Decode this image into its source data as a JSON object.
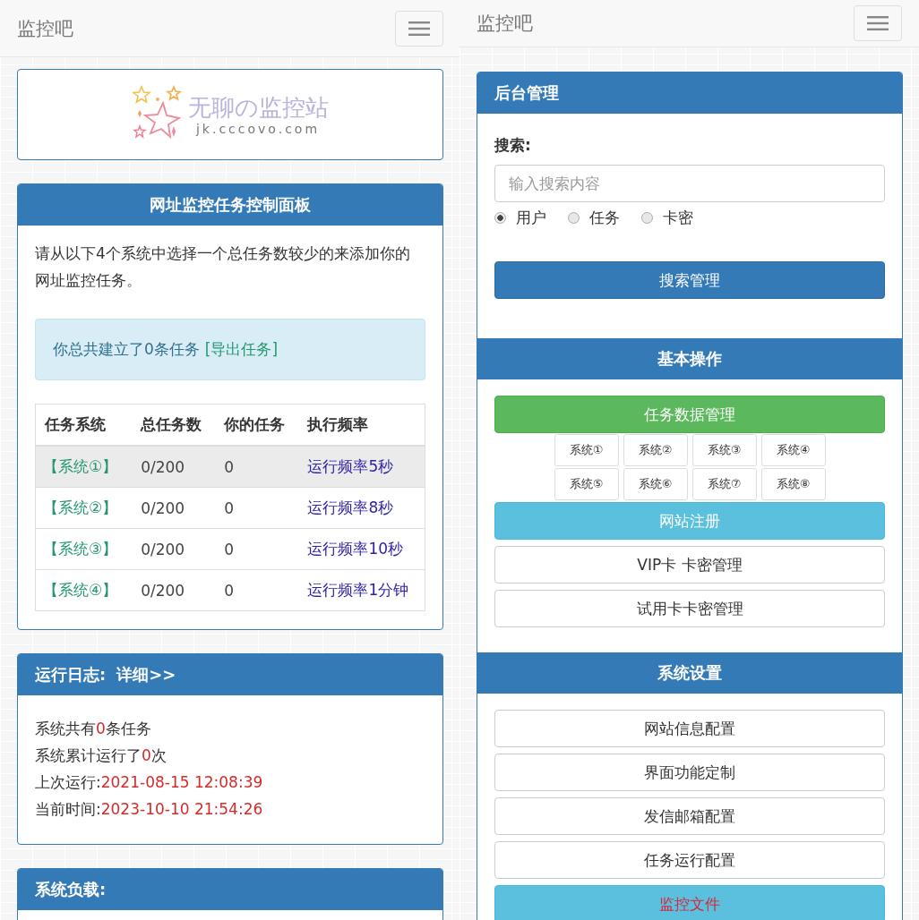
{
  "left_screen": {
    "navbar": {
      "brand": "监控吧"
    },
    "logo": {
      "title": "无聊の监控站",
      "url": "jk.cccovo.com"
    },
    "task_panel": {
      "title": "网址监控任务控制面板",
      "intro": "请从以下4个系统中选择一个总任务数较少的来添加你的网址监控任务。",
      "alert": {
        "text": "你总共建立了0条任务",
        "link": "[导出任务]"
      },
      "table": {
        "columns": [
          "任务系统",
          "总任务数",
          "你的任务",
          "执行频率"
        ],
        "rows": [
          {
            "system": "【系统①】",
            "total": "0/200",
            "mine": "0",
            "frequency": "运行频率5秒",
            "hovered": true
          },
          {
            "system": "【系统②】",
            "total": "0/200",
            "mine": "0",
            "frequency": "运行频率8秒",
            "hovered": false
          },
          {
            "system": "【系统③】",
            "total": "0/200",
            "mine": "0",
            "frequency": "运行频率10秒",
            "hovered": false
          },
          {
            "system": "【系统④】",
            "total": "0/200",
            "mine": "0",
            "frequency": "运行频率1分钟",
            "hovered": false
          }
        ]
      }
    },
    "log_panel": {
      "title": "运行日志:",
      "link": "详细>>",
      "lines": [
        {
          "before": "系统共有",
          "value": "0",
          "after": "条任务"
        },
        {
          "before": "系统累计运行了",
          "value": "0",
          "after": "次"
        },
        {
          "before": "上次运行:",
          "value": "2021-08-15 12:08:39"
        },
        {
          "before": "当前时间:",
          "value": "2023-10-10 21:54:26"
        }
      ]
    },
    "load_panel": {
      "title": "系统负载:"
    }
  },
  "right_screen": {
    "navbar": {
      "brand": "监控吧"
    },
    "admin_panel": {
      "title": "后台管理",
      "search_label": "搜索:",
      "placeholder": "输入搜索内容",
      "radios": [
        {
          "label": "用户",
          "selected": true
        },
        {
          "label": "任务",
          "selected": false
        },
        {
          "label": "卡密",
          "selected": false
        }
      ],
      "button": "搜索管理"
    },
    "basic_panel": {
      "title": "基本操作",
      "top_button": {
        "label": "任务数据管理",
        "kind": "success"
      },
      "systems": [
        "系统①",
        "系统②",
        "系统③",
        "系统④",
        "系统⑤",
        "系统⑥",
        "系统⑦",
        "系统⑧"
      ],
      "buttons": [
        {
          "label": "网站注册",
          "kind": "info"
        },
        {
          "label": "VIP卡 卡密管理",
          "kind": "default"
        },
        {
          "label": "试用卡卡密管理",
          "kind": "default"
        }
      ]
    },
    "settings_panel": {
      "title": "系统设置",
      "buttons": [
        {
          "label": "网站信息配置",
          "kind": "default"
        },
        {
          "label": "界面功能定制",
          "kind": "default"
        },
        {
          "label": "发信邮箱配置",
          "kind": "default"
        },
        {
          "label": "任务运行配置",
          "kind": "default"
        },
        {
          "label": "监控文件",
          "kind": "alert"
        }
      ]
    }
  }
}
